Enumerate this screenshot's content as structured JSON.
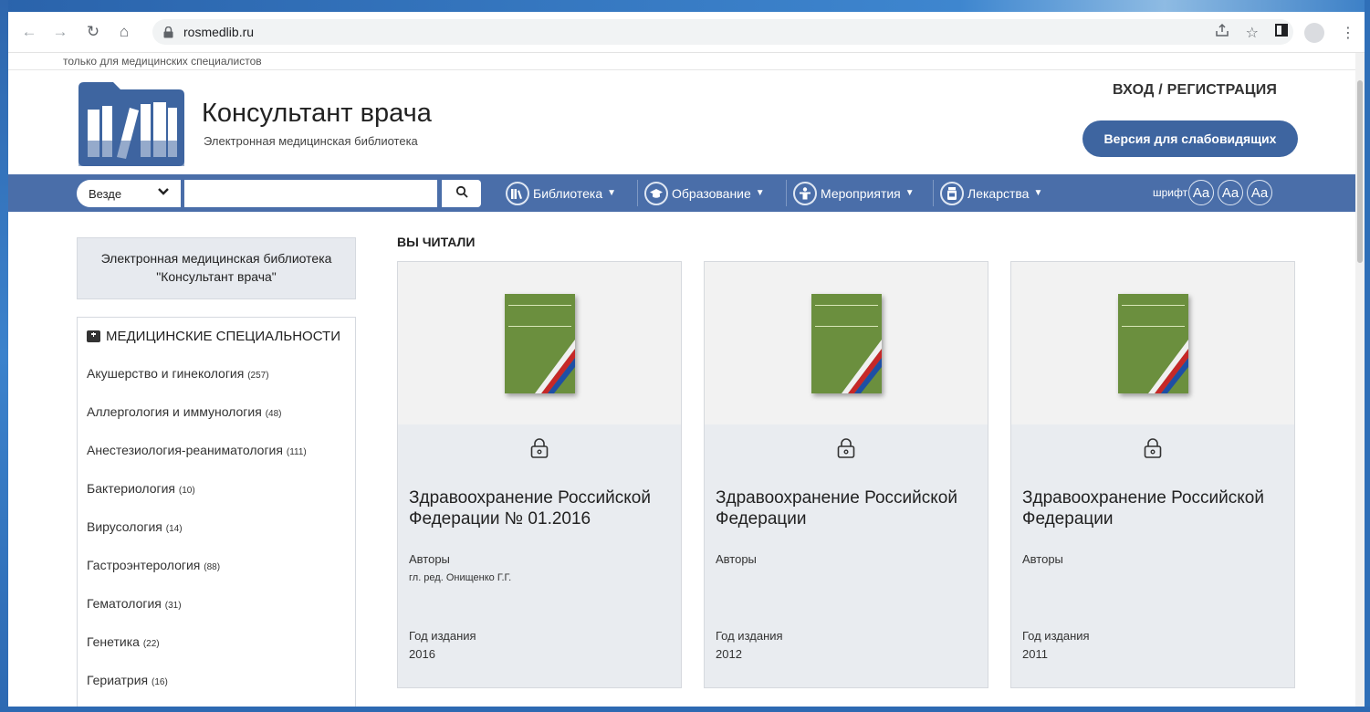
{
  "browser": {
    "url": "rosmedlib.ru"
  },
  "site": {
    "notice": "только для медицинских специалистов",
    "title": "Консультант врача",
    "subtitle": "Электронная медицинская библиотека",
    "login_label": "ВХОД / РЕГИСТРАЦИЯ",
    "low_vision_label": "Версия для слабовидящих"
  },
  "nav": {
    "scope_label": "Везде",
    "search_value": "",
    "menu": [
      {
        "label": "Библиотека",
        "icon": "books-icon"
      },
      {
        "label": "Образование",
        "icon": "graduation-cap-icon"
      },
      {
        "label": "Мероприятия",
        "icon": "presenter-icon"
      },
      {
        "label": "Лекарства",
        "icon": "pill-jar-icon"
      }
    ],
    "font_label": "шрифт",
    "font_buttons": [
      "Aa",
      "Aa",
      "Aa"
    ]
  },
  "sidebar": {
    "library_box": {
      "line1": "Электронная медицинская библиотека",
      "line2": "\"Консультант врача\""
    },
    "specialties_title": "МЕДИЦИНСКИЕ СПЕЦИАЛЬНОСТИ",
    "specialties": [
      {
        "name": "Акушерство и гинекология",
        "count": "(257)"
      },
      {
        "name": "Аллергология и иммунология",
        "count": "(48)"
      },
      {
        "name": "Анестезиология-реаниматология",
        "count": "(111)"
      },
      {
        "name": "Бактериология",
        "count": "(10)"
      },
      {
        "name": "Вирусология",
        "count": "(14)"
      },
      {
        "name": "Гастроэнтерология",
        "count": "(88)"
      },
      {
        "name": "Гематология",
        "count": "(31)"
      },
      {
        "name": "Генетика",
        "count": "(22)"
      },
      {
        "name": "Гериатрия",
        "count": "(16)"
      }
    ]
  },
  "main": {
    "section_title": "ВЫ ЧИТАЛИ",
    "cards": [
      {
        "title": "Здравоохранение Российской Федерации № 01.2016",
        "authors_label": "Авторы",
        "authors": "гл. ред. Онищенко Г.Г.",
        "year_label": "Год издания",
        "year": "2016"
      },
      {
        "title": "Здравоохранение Российской Федерации",
        "authors_label": "Авторы",
        "authors": "",
        "year_label": "Год издания",
        "year": "2012"
      },
      {
        "title": "Здравоохранение Российской Федерации",
        "authors_label": "Авторы",
        "authors": "",
        "year_label": "Год издания",
        "year": "2011"
      }
    ]
  },
  "colors": {
    "navbar": "#4a6ea9",
    "button": "#3e65a0",
    "cover": "#6b8f3e"
  }
}
